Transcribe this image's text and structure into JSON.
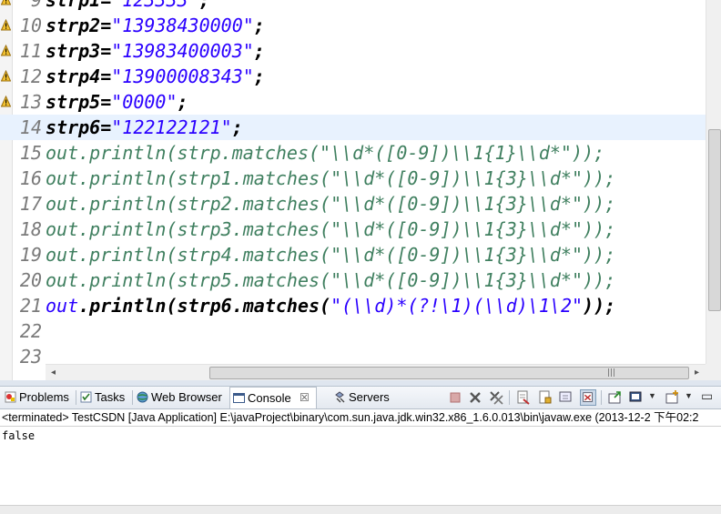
{
  "editor": {
    "lines": [
      {
        "num": "9",
        "code": "strp1=\"123333\";",
        "parts": [
          {
            "t": "strp1=",
            "c": "plain"
          },
          {
            "t": "\"123333\"",
            "c": "str"
          },
          {
            "t": ";",
            "c": "plain"
          }
        ],
        "marker": true
      },
      {
        "num": "10",
        "parts": [
          {
            "t": "strp2=",
            "c": "plain"
          },
          {
            "t": "\"13938430000\"",
            "c": "str"
          },
          {
            "t": ";",
            "c": "plain"
          }
        ],
        "marker": true
      },
      {
        "num": "11",
        "parts": [
          {
            "t": "strp3=",
            "c": "plain"
          },
          {
            "t": "\"13983400003\"",
            "c": "str"
          },
          {
            "t": ";",
            "c": "plain"
          }
        ],
        "marker": true
      },
      {
        "num": "12",
        "parts": [
          {
            "t": "strp4=",
            "c": "plain"
          },
          {
            "t": "\"13900008343\"",
            "c": "str"
          },
          {
            "t": ";",
            "c": "plain"
          }
        ],
        "marker": true
      },
      {
        "num": "13",
        "parts": [
          {
            "t": "strp5=",
            "c": "plain"
          },
          {
            "t": "\"0000\"",
            "c": "str"
          },
          {
            "t": ";",
            "c": "plain"
          }
        ],
        "marker": true
      },
      {
        "num": "14",
        "parts": [
          {
            "t": "strp6=",
            "c": "plain"
          },
          {
            "t": "\"122122121\"",
            "c": "str"
          },
          {
            "t": ";",
            "c": "plain"
          }
        ],
        "marker": false,
        "current": true
      },
      {
        "num": "15",
        "green": true,
        "parts": [
          {
            "t": "out.println(strp.matches(\"\\\\d*([0-9])\\\\1{1}\\\\d*\"));",
            "c": "g"
          }
        ]
      },
      {
        "num": "16",
        "green": true,
        "parts": [
          {
            "t": "out.println(strp1.matches(\"\\\\d*([0-9])\\\\1{3}\\\\d*\"));",
            "c": "g"
          }
        ]
      },
      {
        "num": "17",
        "green": true,
        "parts": [
          {
            "t": "out.println(strp2.matches(\"\\\\d*([0-9])\\\\1{3}\\\\d*\"));",
            "c": "g"
          }
        ]
      },
      {
        "num": "18",
        "green": true,
        "parts": [
          {
            "t": "out.println(strp3.matches(\"\\\\d*([0-9])\\\\1{3}\\\\d*\"));",
            "c": "g"
          }
        ]
      },
      {
        "num": "19",
        "green": true,
        "parts": [
          {
            "t": "out.println(strp4.matches(\"\\\\d*([0-9])\\\\1{3}\\\\d*\"));",
            "c": "g"
          }
        ]
      },
      {
        "num": "20",
        "green": true,
        "parts": [
          {
            "t": "out.println(strp5.matches(\"\\\\d*([0-9])\\\\1{3}\\\\d*\"));",
            "c": "g"
          }
        ]
      },
      {
        "num": "21",
        "parts": [
          {
            "t": "out",
            "c": "str"
          },
          {
            "t": ".println(strp6.matches(",
            "c": "plain"
          },
          {
            "t": "\"(\\\\d)*(?!\\1)(\\\\d)\\1\\2\"",
            "c": "str"
          },
          {
            "t": "));",
            "c": "plain"
          }
        ]
      },
      {
        "num": "22",
        "parts": []
      },
      {
        "num": "23",
        "parts": []
      }
    ]
  },
  "views": {
    "tabs": [
      {
        "label": "Problems",
        "icon": "problems-icon"
      },
      {
        "label": "Tasks",
        "icon": "tasks-icon"
      },
      {
        "label": "Web Browser",
        "icon": "globe-icon"
      },
      {
        "label": "Console",
        "icon": "console-icon",
        "active": true,
        "close": "☒"
      },
      {
        "label": "Servers",
        "icon": "servers-icon"
      }
    ]
  },
  "console": {
    "launch_info": "<terminated> TestCSDN [Java Application] E:\\javaProject\\binary\\com.sun.java.jdk.win32.x86_1.6.0.013\\bin\\javaw.exe (2013-12-2 下午02:2",
    "output": "false"
  },
  "colors": {
    "string": "#2a00ff",
    "comment": "#3f7f5f",
    "current_line": "#e8f2fe"
  }
}
